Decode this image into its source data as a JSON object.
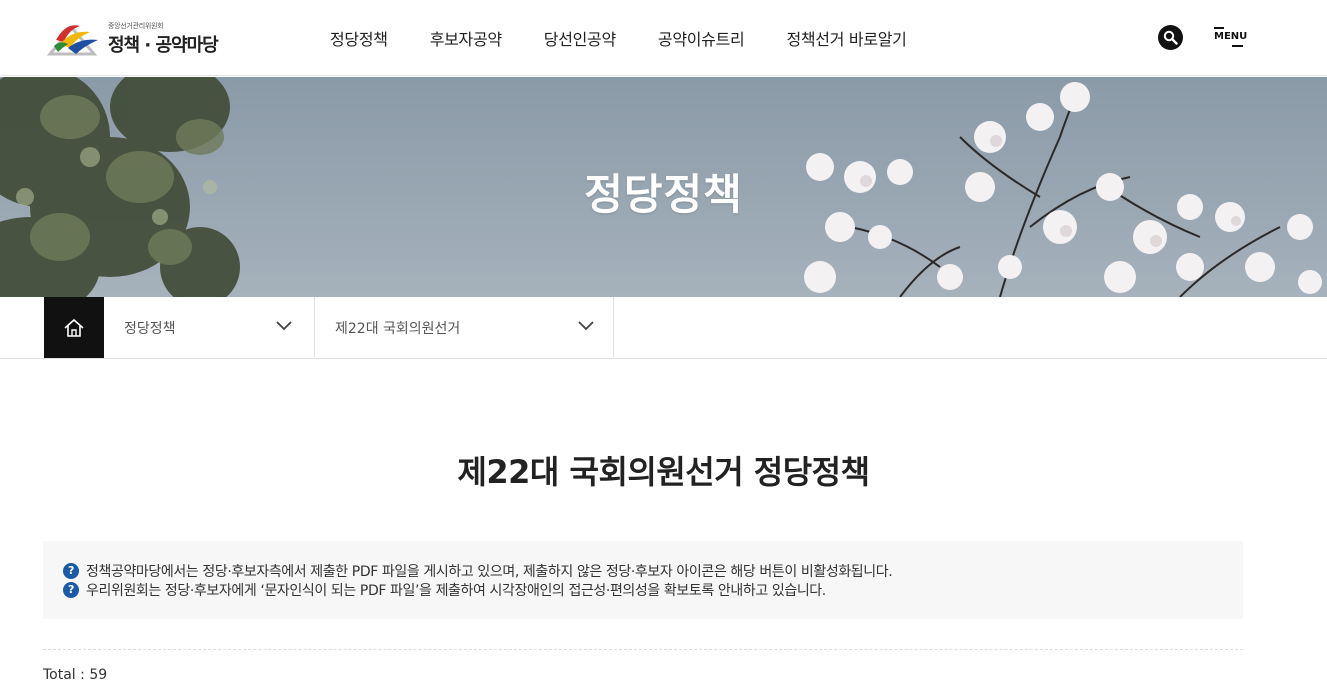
{
  "header": {
    "logo_org": "중앙선거관리위원회",
    "logo_title": "정책 · 공약마당",
    "nav": [
      "정당정책",
      "후보자공약",
      "당선인공약",
      "공약이슈트리",
      "정책선거 바로알기"
    ],
    "search_icon": "search-icon",
    "menu_label": "MENU"
  },
  "hero": {
    "title": "정당정책"
  },
  "location": {
    "home_icon": "home-icon",
    "select1": "정당정책",
    "select2": "제22대 국회의원선거"
  },
  "main": {
    "title": "제22대 국회의원선거 정당정책",
    "notices": [
      "정책공약마당에서는 정당·후보자측에서 제출한 PDF 파일을 게시하고 있으며, 제출하지 않은 정당·후보자 아이콘은 해당 버튼이 비활성화됩니다.",
      "우리위원회는 정당·후보자에게 ‘문자인식이 되는 PDF 파일’을 제출하여 시각장애인의 접근성·편의성을 확보토록 안내하고 있습니다."
    ],
    "notice_icon": "question-icon",
    "total_text": "Total : 59"
  },
  "colors": {
    "accent_dark": "#111111",
    "notice_icon": "#1a5aa8",
    "hero_sky": "#9aa8b4"
  }
}
